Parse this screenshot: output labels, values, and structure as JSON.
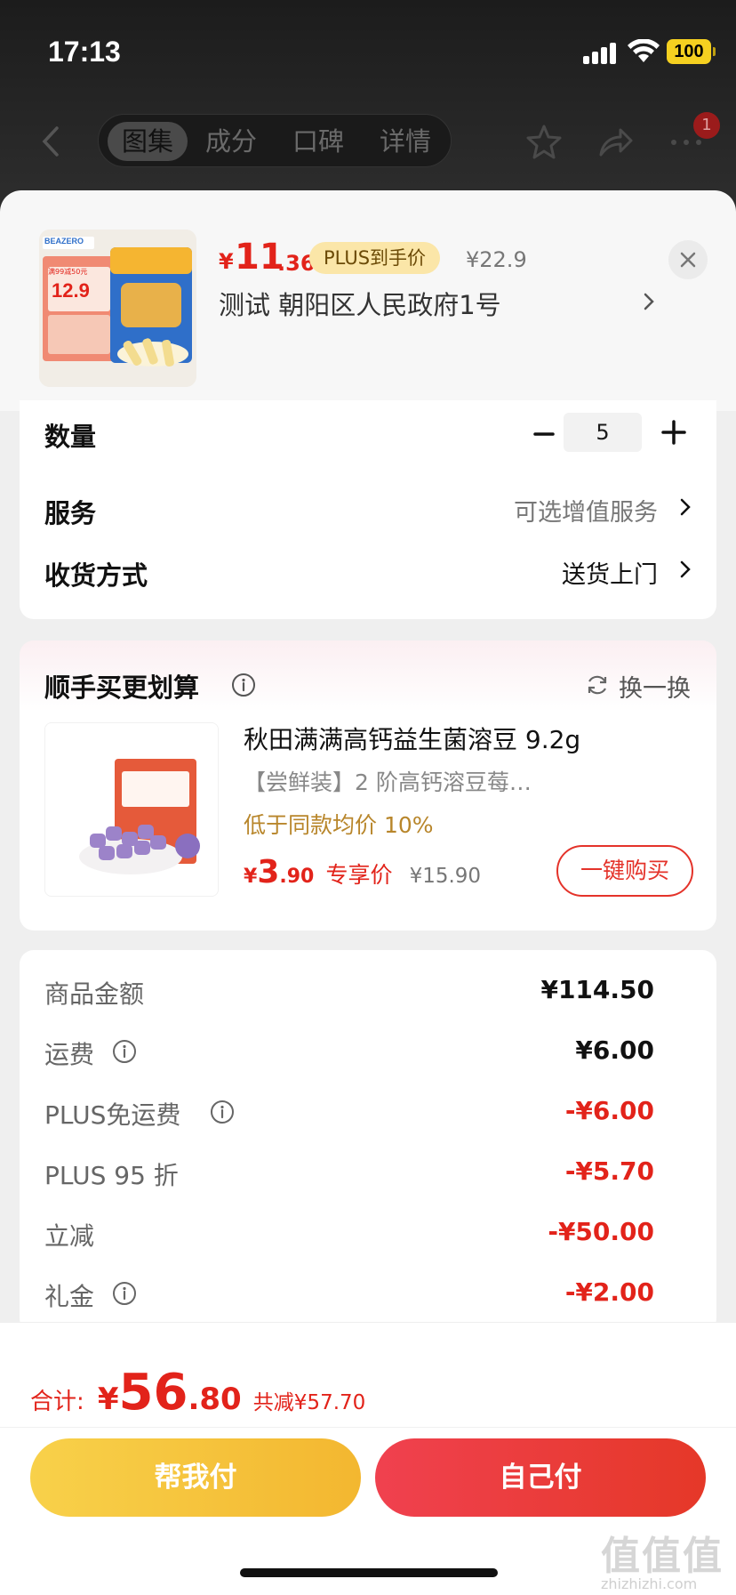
{
  "status_bar": {
    "time": "17:13",
    "battery": "100"
  },
  "header": {
    "tabs": [
      "图集",
      "成分",
      "口碑",
      "详情"
    ],
    "active_tab_index": 0,
    "cart_badge": "1"
  },
  "product": {
    "price_symbol": "¥",
    "price_int": "11",
    "price_dec": ".36",
    "plus_tag": "PLUS到手价",
    "original_price": "¥22.9",
    "address": "测试  朝阳区人民政府1号",
    "image_brand": "BEAZERO",
    "image_badge_price": "12.9",
    "image_badge_top": "满99减50元"
  },
  "options": {
    "quantity_label": "数量",
    "quantity_value": "5",
    "service_label": "服务",
    "service_value": "可选增值服务",
    "delivery_label": "收货方式",
    "delivery_value": "送货上门"
  },
  "recommend": {
    "title": "顺手买更划算",
    "refresh_label": "换一换",
    "item_name": "秋田满满高钙益生菌溶豆 9.2g",
    "item_sub": "【尝鲜装】2 阶高钙溶豆莓…",
    "item_desc": "低于同款均价 10%",
    "price_symbol": "¥",
    "price_int": "3",
    "price_dec": ".90",
    "price_tag": "专享价",
    "original_price": "¥15.90",
    "buy_label": "一键购买"
  },
  "summary": {
    "rows": [
      {
        "label": "商品金额",
        "value": "¥114.50",
        "info": false,
        "negative": false
      },
      {
        "label": "运费",
        "value": "¥6.00",
        "info": true,
        "negative": false
      },
      {
        "label": "PLUS免运费",
        "value": "-¥6.00",
        "info": true,
        "negative": true
      },
      {
        "label": "PLUS 95 折",
        "value": "-¥5.70",
        "info": false,
        "negative": true
      },
      {
        "label": "立减",
        "value": "-¥50.00",
        "info": false,
        "negative": true
      },
      {
        "label": "礼金",
        "value": "-¥2.00",
        "info": true,
        "negative": true
      }
    ]
  },
  "bottom": {
    "total_label": "合计:",
    "total_symbol": "¥",
    "total_int": "56",
    "total_dec": ".80",
    "saved_text": "共减¥57.70",
    "help_pay_label": "帮我付",
    "self_pay_label": "自己付"
  },
  "watermark": {
    "main": "值值值",
    "sub": "zhizhizhi.com"
  },
  "colors": {
    "accent_red": "#e2231a",
    "plus_gold": "#fbe6a8",
    "help_btn": "#f3b730",
    "self_btn": "#e53828"
  }
}
